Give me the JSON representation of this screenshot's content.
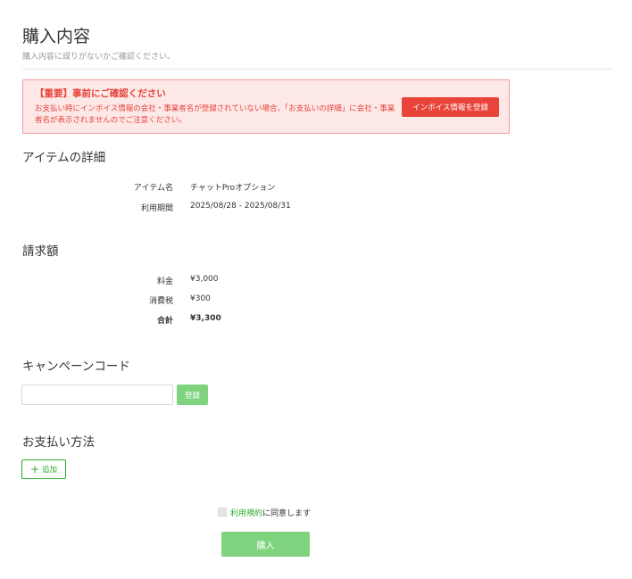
{
  "header": {
    "title": "購入内容",
    "subtitle": "購入内容に誤りがないかご確認ください。"
  },
  "alert": {
    "title": "【重要】事前にご確認ください",
    "body": "お支払い時にインボイス情報の会社・事業者名が登録されていない場合、「お支払いの詳細」に会社・事業者名が表示されませんのでご注意ください。",
    "button_label": "インボイス情報を登録",
    "color": "#e8443a",
    "background": "#fde8e8"
  },
  "item_details": {
    "title": "アイテムの詳細",
    "rows": [
      {
        "label": "アイテム名",
        "value": "チャットProオプション"
      },
      {
        "label": "利用期間",
        "value": "2025/08/28 - 2025/08/31"
      }
    ]
  },
  "billing": {
    "title": "請求額",
    "rows": [
      {
        "label": "料金",
        "value": "¥3,000"
      },
      {
        "label": "消費税",
        "value": "¥300"
      },
      {
        "label": "合計",
        "value": "¥3,300"
      }
    ]
  },
  "campaign": {
    "title": "キャンペーンコード",
    "input_value": "",
    "input_placeholder": "",
    "button_label": "登録"
  },
  "payment": {
    "title": "お支払い方法",
    "add_label": "追加",
    "add_icon": "plus-icon"
  },
  "terms": {
    "checked": false,
    "link_text": "利用規約",
    "suffix": "に同意します"
  },
  "purchase": {
    "button_label": "購入",
    "accent": "#7fd37f",
    "link_color": "#2aab2a"
  }
}
